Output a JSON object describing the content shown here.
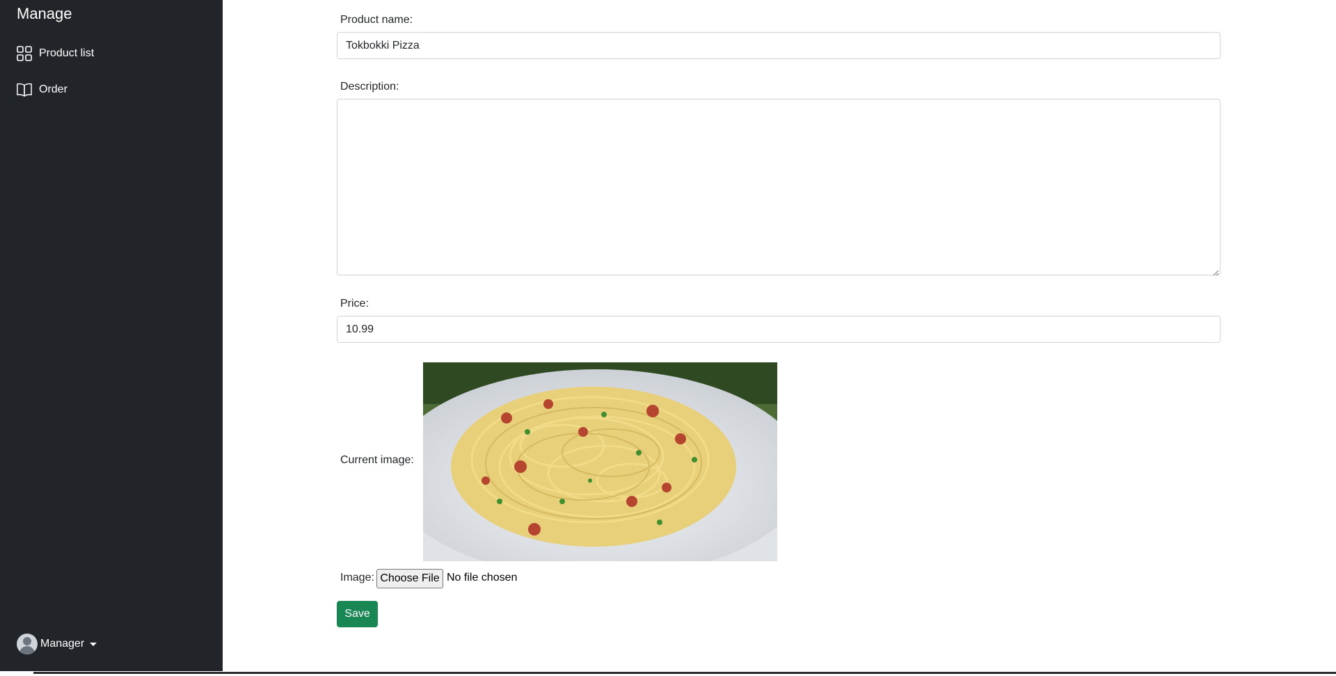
{
  "sidebar": {
    "brand": "Manage",
    "items": [
      {
        "label": "Product list",
        "icon": "grid-icon"
      },
      {
        "label": "Order",
        "icon": "book-icon"
      }
    ],
    "user": {
      "name": "Manager",
      "icon": "avatar"
    }
  },
  "form": {
    "product_name": {
      "label": "Product name:",
      "value": "Tokbokki Pizza"
    },
    "description": {
      "label": "Description:",
      "value": ""
    },
    "price": {
      "label": "Price:",
      "value": "10.99"
    },
    "current_image": {
      "label": "Current image:"
    },
    "image_upload": {
      "label": "Image:",
      "button": "Choose File",
      "status": "No file chosen"
    },
    "save_label": "Save"
  },
  "colors": {
    "sidebar_bg": "#212529",
    "save_button": "#198754",
    "input_border": "#ced4da"
  }
}
